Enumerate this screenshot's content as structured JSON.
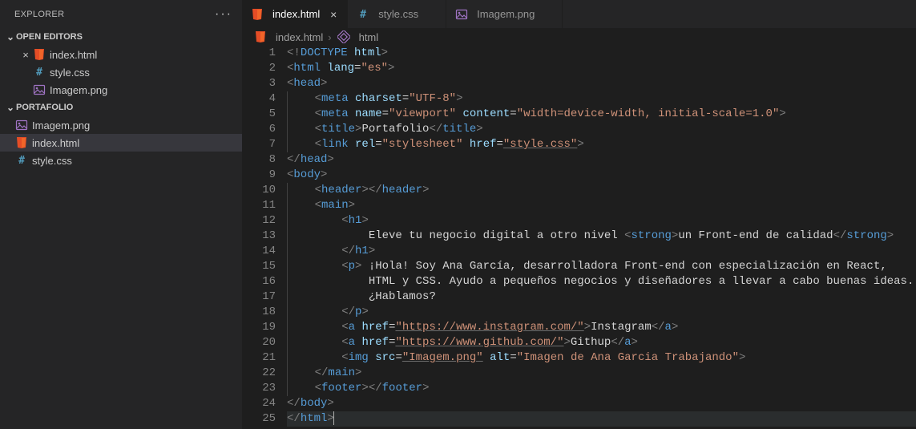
{
  "sidebar": {
    "title": "EXPLORER",
    "sections": {
      "openEditors": {
        "label": "OPEN EDITORS",
        "items": [
          {
            "name": "index.html",
            "icon": "html",
            "closeable": true
          },
          {
            "name": "style.css",
            "icon": "css",
            "closeable": false
          },
          {
            "name": "Imagem.png",
            "icon": "image",
            "closeable": false
          }
        ]
      },
      "folder": {
        "label": "PORTAFOLIO",
        "items": [
          {
            "name": "Imagem.png",
            "icon": "image"
          },
          {
            "name": "index.html",
            "icon": "html",
            "selected": true
          },
          {
            "name": "style.css",
            "icon": "css"
          }
        ]
      }
    }
  },
  "tabs": [
    {
      "name": "index.html",
      "icon": "html",
      "active": true,
      "closeVisible": true
    },
    {
      "name": "style.css",
      "icon": "css",
      "active": false,
      "closeVisible": false
    },
    {
      "name": "Imagem.png",
      "icon": "image",
      "active": false,
      "closeVisible": false
    }
  ],
  "breadcrumb": {
    "file": "index.html",
    "symbol": "html"
  },
  "code": {
    "lines": [
      {
        "n": 1,
        "tokens": [
          [
            "br",
            "<!"
          ],
          [
            "doct",
            "DOCTYPE"
          ],
          [
            "text",
            " "
          ],
          [
            "attr",
            "html"
          ],
          [
            "br",
            ">"
          ]
        ],
        "indent": 0
      },
      {
        "n": 2,
        "tokens": [
          [
            "br",
            "<"
          ],
          [
            "tag",
            "html"
          ],
          [
            "text",
            " "
          ],
          [
            "attr",
            "lang"
          ],
          [
            "eq",
            "="
          ],
          [
            "str",
            "\"es\""
          ],
          [
            "br",
            ">"
          ]
        ],
        "indent": 0
      },
      {
        "n": 3,
        "tokens": [
          [
            "br",
            "<"
          ],
          [
            "tag",
            "head"
          ],
          [
            "br",
            ">"
          ]
        ],
        "indent": 0
      },
      {
        "n": 4,
        "tokens": [
          [
            "br",
            "<"
          ],
          [
            "tag",
            "meta"
          ],
          [
            "text",
            " "
          ],
          [
            "attr",
            "charset"
          ],
          [
            "eq",
            "="
          ],
          [
            "str",
            "\"UTF-8\""
          ],
          [
            "br",
            ">"
          ]
        ],
        "indent": 1
      },
      {
        "n": 5,
        "tokens": [
          [
            "br",
            "<"
          ],
          [
            "tag",
            "meta"
          ],
          [
            "text",
            " "
          ],
          [
            "attr",
            "name"
          ],
          [
            "eq",
            "="
          ],
          [
            "str",
            "\"viewport\""
          ],
          [
            "text",
            " "
          ],
          [
            "attr",
            "content"
          ],
          [
            "eq",
            "="
          ],
          [
            "str",
            "\"width=device-width, initial-scale=1.0\""
          ],
          [
            "br",
            ">"
          ]
        ],
        "indent": 1
      },
      {
        "n": 6,
        "tokens": [
          [
            "br",
            "<"
          ],
          [
            "tag",
            "title"
          ],
          [
            "br",
            ">"
          ],
          [
            "text",
            "Portafolio"
          ],
          [
            "br",
            "</"
          ],
          [
            "tag",
            "title"
          ],
          [
            "br",
            ">"
          ]
        ],
        "indent": 1
      },
      {
        "n": 7,
        "tokens": [
          [
            "br",
            "<"
          ],
          [
            "tag",
            "link"
          ],
          [
            "text",
            " "
          ],
          [
            "attr",
            "rel"
          ],
          [
            "eq",
            "="
          ],
          [
            "str",
            "\"stylesheet\""
          ],
          [
            "text",
            " "
          ],
          [
            "attr",
            "href"
          ],
          [
            "eq",
            "="
          ],
          [
            "str-u",
            "\"style.css\""
          ],
          [
            "br",
            ">"
          ]
        ],
        "indent": 1
      },
      {
        "n": 8,
        "tokens": [
          [
            "br",
            "</"
          ],
          [
            "tag",
            "head"
          ],
          [
            "br",
            ">"
          ]
        ],
        "indent": 0
      },
      {
        "n": 9,
        "tokens": [
          [
            "br",
            "<"
          ],
          [
            "tag",
            "body"
          ],
          [
            "br",
            ">"
          ]
        ],
        "indent": 0
      },
      {
        "n": 10,
        "tokens": [
          [
            "br",
            "<"
          ],
          [
            "tag",
            "header"
          ],
          [
            "br",
            "></"
          ],
          [
            "tag",
            "header"
          ],
          [
            "br",
            ">"
          ]
        ],
        "indent": 1
      },
      {
        "n": 11,
        "tokens": [
          [
            "br",
            "<"
          ],
          [
            "tag",
            "main"
          ],
          [
            "br",
            ">"
          ]
        ],
        "indent": 1
      },
      {
        "n": 12,
        "tokens": [
          [
            "br",
            "<"
          ],
          [
            "tag",
            "h1"
          ],
          [
            "br",
            ">"
          ]
        ],
        "indent": 2
      },
      {
        "n": 13,
        "tokens": [
          [
            "text",
            "Eleve tu negocio digital a otro nivel "
          ],
          [
            "br",
            "<"
          ],
          [
            "tag",
            "strong"
          ],
          [
            "br",
            ">"
          ],
          [
            "text",
            "un Front-end de calidad"
          ],
          [
            "br",
            "</"
          ],
          [
            "tag",
            "strong"
          ],
          [
            "br",
            ">"
          ]
        ],
        "indent": 3
      },
      {
        "n": 14,
        "tokens": [
          [
            "br",
            "</"
          ],
          [
            "tag",
            "h1"
          ],
          [
            "br",
            ">"
          ]
        ],
        "indent": 2
      },
      {
        "n": 15,
        "tokens": [
          [
            "br",
            "<"
          ],
          [
            "tag",
            "p"
          ],
          [
            "br",
            ">"
          ],
          [
            "text",
            " ¡Hola! Soy Ana García, desarrolladora Front-end con especialización en React,"
          ]
        ],
        "indent": 2
      },
      {
        "n": 16,
        "tokens": [
          [
            "text",
            "HTML y CSS. Ayudo a pequeños negocios y diseñadores a llevar a cabo buenas ideas."
          ]
        ],
        "indent": 3
      },
      {
        "n": 17,
        "tokens": [
          [
            "text",
            "¿Hablamos?"
          ]
        ],
        "indent": 3
      },
      {
        "n": 18,
        "tokens": [
          [
            "br",
            "</"
          ],
          [
            "tag",
            "p"
          ],
          [
            "br",
            ">"
          ]
        ],
        "indent": 2
      },
      {
        "n": 19,
        "tokens": [
          [
            "br",
            "<"
          ],
          [
            "tag",
            "a"
          ],
          [
            "text",
            " "
          ],
          [
            "attr",
            "href"
          ],
          [
            "eq",
            "="
          ],
          [
            "str-u",
            "\"https://www.instagram.com/\""
          ],
          [
            "br",
            ">"
          ],
          [
            "text",
            "Instagram"
          ],
          [
            "br",
            "</"
          ],
          [
            "tag",
            "a"
          ],
          [
            "br",
            ">"
          ]
        ],
        "indent": 2
      },
      {
        "n": 20,
        "tokens": [
          [
            "br",
            "<"
          ],
          [
            "tag",
            "a"
          ],
          [
            "text",
            " "
          ],
          [
            "attr",
            "href"
          ],
          [
            "eq",
            "="
          ],
          [
            "str-u",
            "\"https://www.github.com/\""
          ],
          [
            "br",
            ">"
          ],
          [
            "text",
            "Githup"
          ],
          [
            "br",
            "</"
          ],
          [
            "tag",
            "a"
          ],
          [
            "br",
            ">"
          ]
        ],
        "indent": 2
      },
      {
        "n": 21,
        "tokens": [
          [
            "br",
            "<"
          ],
          [
            "tag",
            "img"
          ],
          [
            "text",
            " "
          ],
          [
            "attr",
            "src"
          ],
          [
            "eq",
            "="
          ],
          [
            "str-u",
            "\"Imagem.png\""
          ],
          [
            "text",
            " "
          ],
          [
            "attr",
            "alt"
          ],
          [
            "eq",
            "="
          ],
          [
            "str",
            "\"Imagen de Ana Garcia Trabajando\""
          ],
          [
            "br",
            ">"
          ]
        ],
        "indent": 2
      },
      {
        "n": 22,
        "tokens": [
          [
            "br",
            "</"
          ],
          [
            "tag",
            "main"
          ],
          [
            "br",
            ">"
          ]
        ],
        "indent": 1
      },
      {
        "n": 23,
        "tokens": [
          [
            "br",
            "<"
          ],
          [
            "tag",
            "footer"
          ],
          [
            "br",
            "></"
          ],
          [
            "tag",
            "footer"
          ],
          [
            "br",
            ">"
          ]
        ],
        "indent": 1
      },
      {
        "n": 24,
        "tokens": [
          [
            "br",
            "</"
          ],
          [
            "tag",
            "body"
          ],
          [
            "br",
            ">"
          ]
        ],
        "indent": 0
      },
      {
        "n": 25,
        "tokens": [
          [
            "br",
            "</"
          ],
          [
            "tag",
            "html"
          ],
          [
            "br",
            ">"
          ]
        ],
        "indent": 0,
        "cursor": true,
        "highlight": true
      }
    ]
  }
}
